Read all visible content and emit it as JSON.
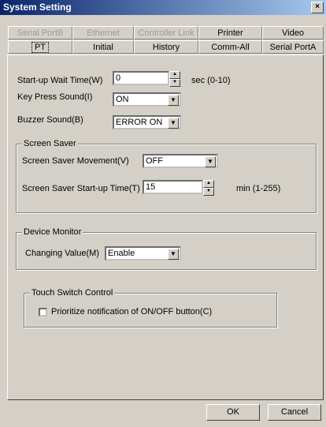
{
  "window": {
    "title": "System Setting",
    "close_symbol": "×"
  },
  "tabs_back": [
    {
      "label": "Serial PortB",
      "disabled": true
    },
    {
      "label": "Ethernet",
      "disabled": true
    },
    {
      "label": "Controller Link",
      "disabled": true
    },
    {
      "label": "Printer",
      "disabled": false
    },
    {
      "label": "Video",
      "disabled": false
    }
  ],
  "tabs_front": [
    {
      "label": "PT",
      "active": true
    },
    {
      "label": "Initial"
    },
    {
      "label": "History"
    },
    {
      "label": "Comm-All"
    },
    {
      "label": "Serial PortA"
    }
  ],
  "startup": {
    "label": "Start-up Wait Time(W)",
    "value": "0",
    "unit": "sec (0-10)"
  },
  "key_press": {
    "label": "Key Press Sound(I)",
    "value": "ON"
  },
  "buzzer": {
    "label": "Buzzer Sound(B)",
    "value": "ERROR ON"
  },
  "screen_saver": {
    "legend": "Screen Saver",
    "movement_label": "Screen Saver Movement(V)",
    "movement_value": "OFF",
    "startup_label": "Screen Saver Start-up Time(T)",
    "startup_value": "15",
    "startup_unit": "min (1-255)"
  },
  "device_monitor": {
    "legend": "Device Monitor",
    "label": "Changing Value(M)",
    "value": "Enable"
  },
  "touch_switch": {
    "legend": "Touch Switch Control",
    "checkbox_label": "Prioritize notification of ON/OFF button(C)",
    "checked": false
  },
  "buttons": {
    "ok": "OK",
    "cancel": "Cancel"
  }
}
